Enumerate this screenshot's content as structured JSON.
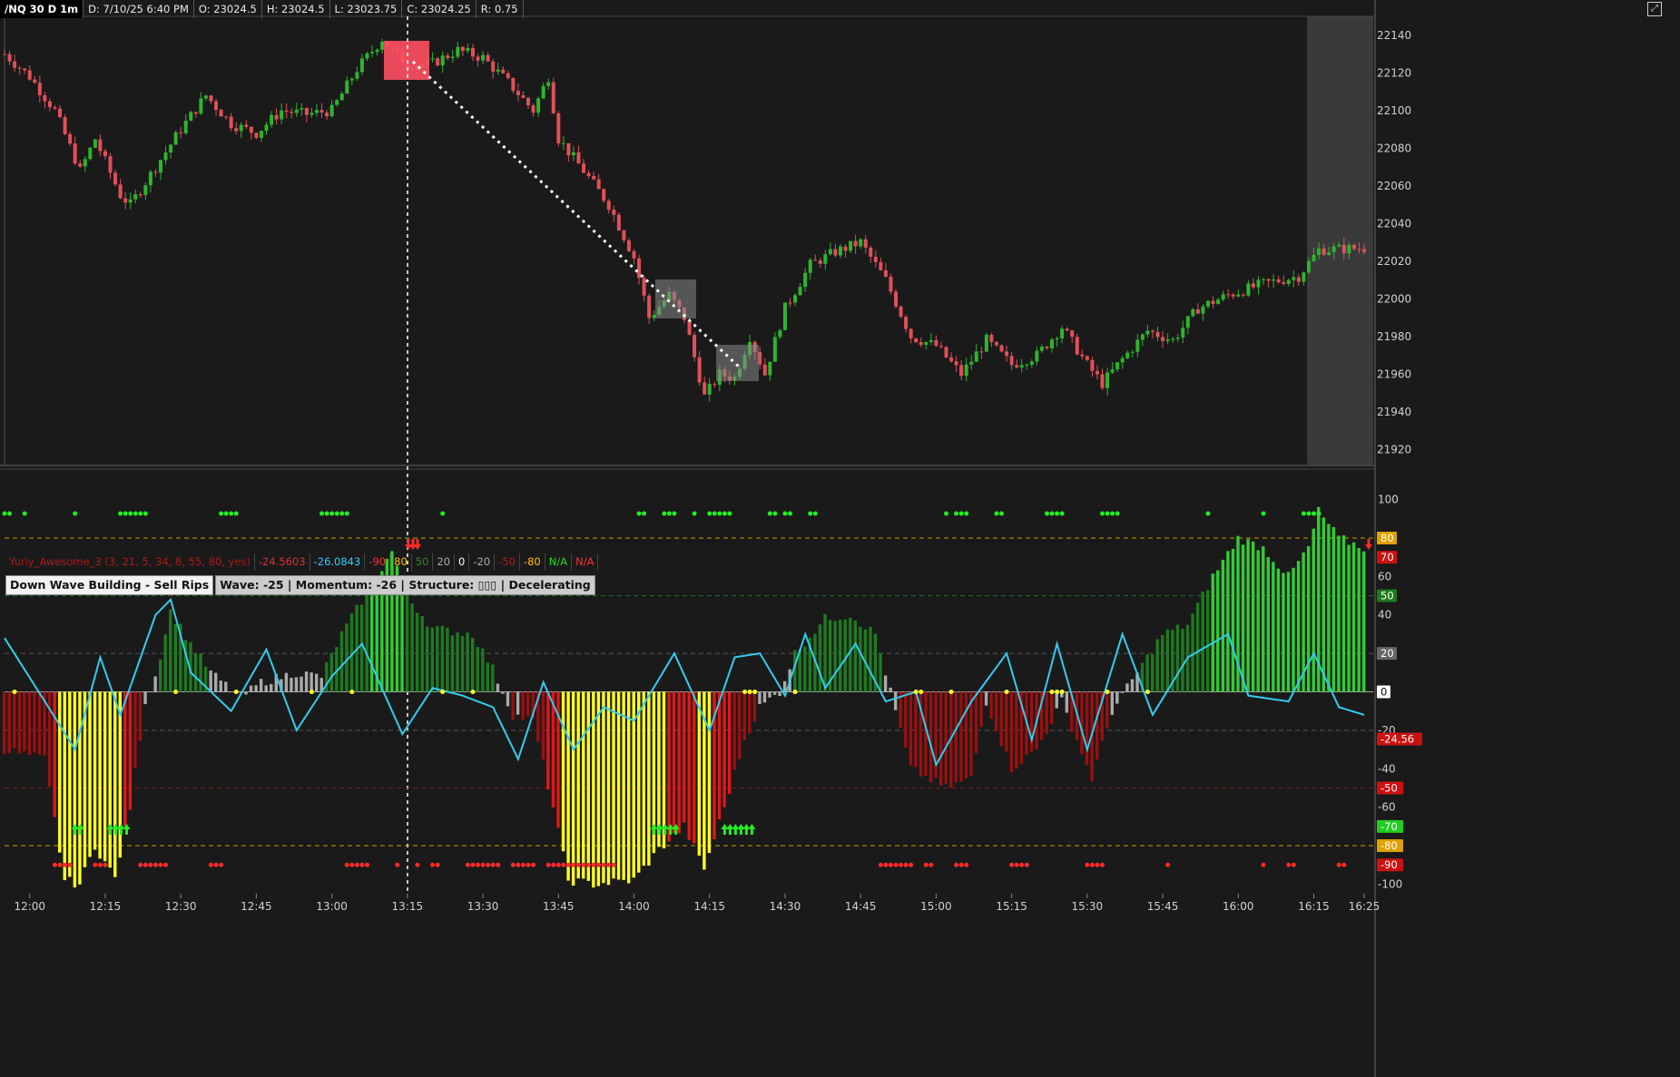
{
  "header": {
    "symbol": "/NQ 30 D 1m",
    "date": "D: 7/10/25 6:40 PM",
    "open": "O: 23024.5",
    "high": "H: 23024.5",
    "low": "L: 23023.75",
    "close": "C: 23024.25",
    "range": "R: 0.75"
  },
  "indicator_header": {
    "name": "Yuriy_Awesome_3 (3, 21, 5, 34, 8, 55, 80, yes)",
    "values": [
      {
        "text": "-24.5603",
        "color": "#e03030"
      },
      {
        "text": "-26.0843",
        "color": "#33ccff"
      },
      {
        "text": "-90",
        "color": "#ff3030"
      },
      {
        "text": "80",
        "color": "#ffc000"
      },
      {
        "text": "50",
        "color": "#2a8a2a"
      },
      {
        "text": "20",
        "color": "#aaaaaa"
      },
      {
        "text": "0",
        "color": "#ffffff"
      },
      {
        "text": "-20",
        "color": "#aaaaaa"
      },
      {
        "text": "-50",
        "color": "#aa2020"
      },
      {
        "text": "-80",
        "color": "#ffc000"
      },
      {
        "text": "N/A",
        "color": "#22dd22"
      },
      {
        "text": "N/A",
        "color": "#ff3030"
      }
    ]
  },
  "status": {
    "signal": "Down Wave Building - Sell Rips",
    "detail": "Wave: -25 | Momentum: -26 | Structure: ▯▯▯ | Decelerating"
  },
  "colors": {
    "background": "#1a1a1a",
    "up_candle": "#2db52d",
    "down_candle": "#e0505a",
    "osc_green": "#1f7a1f",
    "osc_lightgreen": "#33cc33",
    "osc_red": "#9a1010",
    "osc_brightred": "#e01818",
    "osc_yellow": "#ffff22",
    "osc_gray": "#aaaaaa",
    "signal_line": "#33ccee"
  },
  "chart_data": [
    {
      "type": "candlestick",
      "title": "/NQ 30 D 1m",
      "x_ticks": [
        "12:00",
        "12:15",
        "12:30",
        "12:45",
        "13:00",
        "13:15",
        "13:30",
        "13:45",
        "14:00",
        "14:15",
        "14:30",
        "14:45",
        "15:00",
        "15:15",
        "15:30",
        "15:45",
        "16:00",
        "16:15",
        "16:25"
      ],
      "y_ticks": [
        21920,
        21940,
        21960,
        21980,
        22000,
        22020,
        22040,
        22060,
        22080,
        22100,
        22120,
        22140
      ],
      "ylim": [
        21912,
        22150
      ],
      "price_path_keypoints": [
        {
          "time": "11:55",
          "price": 22130
        },
        {
          "time": "12:00",
          "price": 22118
        },
        {
          "time": "12:05",
          "price": 22100
        },
        {
          "time": "12:10",
          "price": 22068
        },
        {
          "time": "12:13",
          "price": 22085
        },
        {
          "time": "12:18",
          "price": 22055
        },
        {
          "time": "12:20",
          "price": 22050
        },
        {
          "time": "12:25",
          "price": 22070
        },
        {
          "time": "12:30",
          "price": 22090
        },
        {
          "time": "12:35",
          "price": 22108
        },
        {
          "time": "12:40",
          "price": 22093
        },
        {
          "time": "12:45",
          "price": 22088
        },
        {
          "time": "12:50",
          "price": 22100
        },
        {
          "time": "12:55",
          "price": 22098
        },
        {
          "time": "13:00",
          "price": 22100
        },
        {
          "time": "13:05",
          "price": 22122
        },
        {
          "time": "13:10",
          "price": 22138
        },
        {
          "time": "13:15",
          "price": 22124
        },
        {
          "time": "13:20",
          "price": 22125
        },
        {
          "time": "13:25",
          "price": 22132
        },
        {
          "time": "13:30",
          "price": 22128
        },
        {
          "time": "13:35",
          "price": 22115
        },
        {
          "time": "13:40",
          "price": 22100
        },
        {
          "time": "13:43",
          "price": 22118
        },
        {
          "time": "13:45",
          "price": 22085
        },
        {
          "time": "13:50",
          "price": 22068
        },
        {
          "time": "13:55",
          "price": 22050
        },
        {
          "time": "14:00",
          "price": 22022
        },
        {
          "time": "14:03",
          "price": 21990
        },
        {
          "time": "14:07",
          "price": 22002
        },
        {
          "time": "14:10",
          "price": 21990
        },
        {
          "time": "14:14",
          "price": 21948
        },
        {
          "time": "14:17",
          "price": 21960
        },
        {
          "time": "14:20",
          "price": 21958
        },
        {
          "time": "14:23",
          "price": 21980
        },
        {
          "time": "14:26",
          "price": 21960
        },
        {
          "time": "14:30",
          "price": 21995
        },
        {
          "time": "14:35",
          "price": 22018
        },
        {
          "time": "14:40",
          "price": 22025
        },
        {
          "time": "14:45",
          "price": 22030
        },
        {
          "time": "14:50",
          "price": 22010
        },
        {
          "time": "14:55",
          "price": 21980
        },
        {
          "time": "15:00",
          "price": 21975
        },
        {
          "time": "15:05",
          "price": 21960
        },
        {
          "time": "15:10",
          "price": 21978
        },
        {
          "time": "15:15",
          "price": 21965
        },
        {
          "time": "15:20",
          "price": 21970
        },
        {
          "time": "15:25",
          "price": 21985
        },
        {
          "time": "15:30",
          "price": 21965
        },
        {
          "time": "15:33",
          "price": 21955
        },
        {
          "time": "15:37",
          "price": 21968
        },
        {
          "time": "15:42",
          "price": 21983
        },
        {
          "time": "15:47",
          "price": 21978
        },
        {
          "time": "15:52",
          "price": 21995
        },
        {
          "time": "15:58",
          "price": 22002
        },
        {
          "time": "16:05",
          "price": 22008
        },
        {
          "time": "16:12",
          "price": 22012
        },
        {
          "time": "16:16",
          "price": 22026
        },
        {
          "time": "16:25",
          "price": 22027
        }
      ]
    },
    {
      "type": "bar",
      "title": "Yuriy_Awesome_3 (3, 21, 5, 34, 8, 55, 80, yes)",
      "y_ticks": [
        100,
        80,
        60,
        40,
        20,
        0,
        -20,
        -40,
        -60,
        -80,
        -100
      ],
      "ylim": [
        -105,
        105
      ],
      "reference_lines": [
        80,
        50,
        20,
        0,
        -20,
        -50,
        -80
      ],
      "y_badges": [
        {
          "text": "80",
          "value": 80,
          "color": "#e0a000"
        },
        {
          "text": "70",
          "value": 70,
          "color": "#cc1111"
        },
        {
          "text": "50",
          "value": 50,
          "color": "#1e7a1e"
        },
        {
          "text": "20",
          "value": 20,
          "color": "#666666"
        },
        {
          "text": "0",
          "value": 0,
          "color": "#ffffff"
        },
        {
          "text": "-24.56",
          "value": -24.56,
          "color": "#cc1111"
        },
        {
          "text": "-50",
          "value": -50,
          "color": "#cc1111"
        },
        {
          "text": "-70",
          "value": -70,
          "color": "#22cc22"
        },
        {
          "text": "-80",
          "value": -80,
          "color": "#e0a000"
        },
        {
          "text": "-90",
          "value": -90,
          "color": "#cc1111"
        }
      ],
      "histogram_keypoints": [
        {
          "time": "11:55",
          "value": -30
        },
        {
          "time": "12:03",
          "value": -35
        },
        {
          "time": "12:07",
          "value": -98
        },
        {
          "time": "12:10",
          "value": -100
        },
        {
          "time": "12:13",
          "value": -80
        },
        {
          "time": "12:17",
          "value": -97
        },
        {
          "time": "12:20",
          "value": -60
        },
        {
          "time": "12:23",
          "value": -5
        },
        {
          "time": "12:25",
          "value": 8
        },
        {
          "time": "12:28",
          "value": 42
        },
        {
          "time": "12:32",
          "value": 25
        },
        {
          "time": "12:36",
          "value": 10
        },
        {
          "time": "12:42",
          "value": -3
        },
        {
          "time": "12:46",
          "value": 5
        },
        {
          "time": "12:53",
          "value": 10
        },
        {
          "time": "12:58",
          "value": 8
        },
        {
          "time": "13:02",
          "value": 30
        },
        {
          "time": "13:08",
          "value": 56
        },
        {
          "time": "13:12",
          "value": 73
        },
        {
          "time": "13:15",
          "value": 50
        },
        {
          "time": "13:20",
          "value": 33
        },
        {
          "time": "13:28",
          "value": 30
        },
        {
          "time": "13:32",
          "value": 12
        },
        {
          "time": "13:36",
          "value": -12
        },
        {
          "time": "13:40",
          "value": -15
        },
        {
          "time": "13:44",
          "value": -60
        },
        {
          "time": "13:47",
          "value": -98
        },
        {
          "time": "13:52",
          "value": -100
        },
        {
          "time": "14:00",
          "value": -98
        },
        {
          "time": "14:05",
          "value": -82
        },
        {
          "time": "14:10",
          "value": -70
        },
        {
          "time": "14:14",
          "value": -92
        },
        {
          "time": "14:18",
          "value": -60
        },
        {
          "time": "14:22",
          "value": -25
        },
        {
          "time": "14:25",
          "value": -8
        },
        {
          "time": "14:29",
          "value": 0
        },
        {
          "time": "14:32",
          "value": 20
        },
        {
          "time": "14:38",
          "value": 38
        },
        {
          "time": "14:43",
          "value": 40
        },
        {
          "time": "14:48",
          "value": 30
        },
        {
          "time": "14:51",
          "value": 0
        },
        {
          "time": "14:55",
          "value": -40
        },
        {
          "time": "15:02",
          "value": -50
        },
        {
          "time": "15:07",
          "value": -45
        },
        {
          "time": "15:10",
          "value": -5
        },
        {
          "time": "15:15",
          "value": -40
        },
        {
          "time": "15:20",
          "value": -30
        },
        {
          "time": "15:25",
          "value": -5
        },
        {
          "time": "15:31",
          "value": -45
        },
        {
          "time": "15:35",
          "value": -10
        },
        {
          "time": "15:40",
          "value": 10
        },
        {
          "time": "15:45",
          "value": 30
        },
        {
          "time": "15:50",
          "value": 35
        },
        {
          "time": "15:55",
          "value": 60
        },
        {
          "time": "16:00",
          "value": 80
        },
        {
          "time": "16:05",
          "value": 75
        },
        {
          "time": "16:10",
          "value": 60
        },
        {
          "time": "16:14",
          "value": 75
        },
        {
          "time": "16:16",
          "value": 94
        },
        {
          "time": "16:20",
          "value": 80
        },
        {
          "time": "16:25",
          "value": 75
        }
      ],
      "signal_line_keypoints": [
        {
          "time": "11:55",
          "value": 28
        },
        {
          "time": "12:03",
          "value": -5
        },
        {
          "time": "12:09",
          "value": -30
        },
        {
          "time": "12:14",
          "value": 18
        },
        {
          "time": "12:18",
          "value": -12
        },
        {
          "time": "12:25",
          "value": 40
        },
        {
          "time": "12:28",
          "value": 48
        },
        {
          "time": "12:32",
          "value": 10
        },
        {
          "time": "12:40",
          "value": -10
        },
        {
          "time": "12:47",
          "value": 22
        },
        {
          "time": "12:53",
          "value": -20
        },
        {
          "time": "13:00",
          "value": 8
        },
        {
          "time": "13:06",
          "value": 25
        },
        {
          "time": "13:14",
          "value": -22
        },
        {
          "time": "13:20",
          "value": 2
        },
        {
          "time": "13:26",
          "value": -2
        },
        {
          "time": "13:32",
          "value": -8
        },
        {
          "time": "13:37",
          "value": -35
        },
        {
          "time": "13:42",
          "value": 5
        },
        {
          "time": "13:48",
          "value": -30
        },
        {
          "time": "13:54",
          "value": -8
        },
        {
          "time": "14:00",
          "value": -15
        },
        {
          "time": "14:08",
          "value": 20
        },
        {
          "time": "14:15",
          "value": -20
        },
        {
          "time": "14:20",
          "value": 18
        },
        {
          "time": "14:25",
          "value": 20
        },
        {
          "time": "14:30",
          "value": -2
        },
        {
          "time": "14:34",
          "value": 30
        },
        {
          "time": "14:38",
          "value": 2
        },
        {
          "time": "14:44",
          "value": 25
        },
        {
          "time": "14:50",
          "value": -5
        },
        {
          "time": "14:56",
          "value": 0
        },
        {
          "time": "15:00",
          "value": -38
        },
        {
          "time": "15:07",
          "value": -5
        },
        {
          "time": "15:14",
          "value": 20
        },
        {
          "time": "15:19",
          "value": -25
        },
        {
          "time": "15:24",
          "value": 25
        },
        {
          "time": "15:30",
          "value": -30
        },
        {
          "time": "15:37",
          "value": 30
        },
        {
          "time": "15:43",
          "value": -12
        },
        {
          "time": "15:50",
          "value": 18
        },
        {
          "time": "15:58",
          "value": 30
        },
        {
          "time": "16:02",
          "value": -2
        },
        {
          "time": "16:10",
          "value": -5
        },
        {
          "time": "16:15",
          "value": 20
        },
        {
          "time": "16:20",
          "value": -8
        },
        {
          "time": "16:25",
          "value": -12
        }
      ]
    }
  ]
}
